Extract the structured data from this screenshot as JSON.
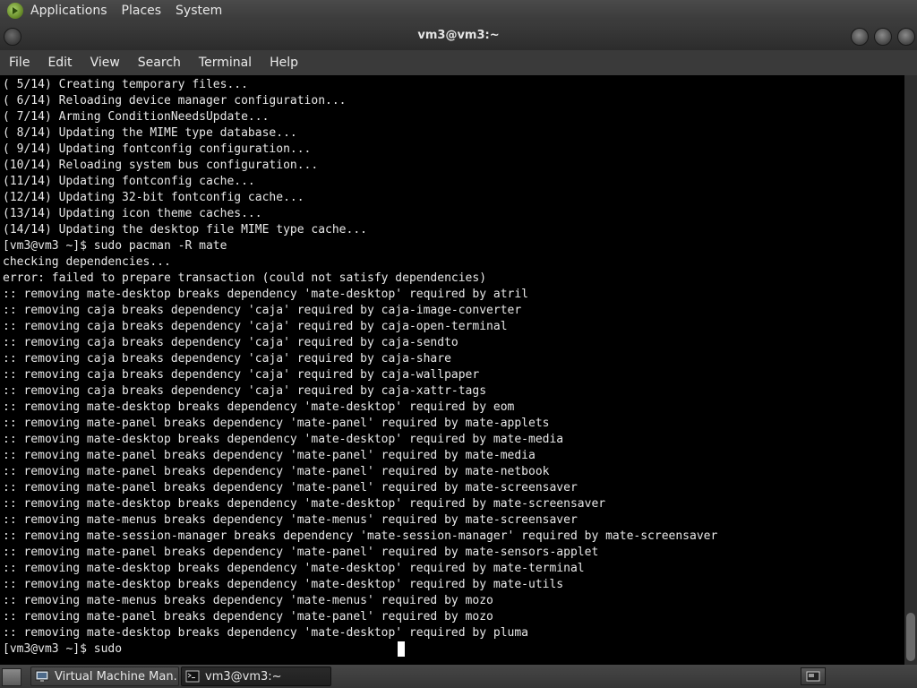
{
  "top_panel": {
    "menus": [
      "Applications",
      "Places",
      "System"
    ]
  },
  "window": {
    "title": "vm3@vm3:~"
  },
  "menubar": {
    "items": [
      "File",
      "Edit",
      "View",
      "Search",
      "Terminal",
      "Help"
    ]
  },
  "terminal": {
    "lines": [
      "( 5/14) Creating temporary files...",
      "( 6/14) Reloading device manager configuration...",
      "( 7/14) Arming ConditionNeedsUpdate...",
      "( 8/14) Updating the MIME type database...",
      "( 9/14) Updating fontconfig configuration...",
      "(10/14) Reloading system bus configuration...",
      "(11/14) Updating fontconfig cache...",
      "(12/14) Updating 32-bit fontconfig cache...",
      "(13/14) Updating icon theme caches...",
      "(14/14) Updating the desktop file MIME type cache...",
      "[vm3@vm3 ~]$ sudo pacman -R mate",
      "checking dependencies...",
      "error: failed to prepare transaction (could not satisfy dependencies)",
      ":: removing mate-desktop breaks dependency 'mate-desktop' required by atril",
      ":: removing caja breaks dependency 'caja' required by caja-image-converter",
      ":: removing caja breaks dependency 'caja' required by caja-open-terminal",
      ":: removing caja breaks dependency 'caja' required by caja-sendto",
      ":: removing caja breaks dependency 'caja' required by caja-share",
      ":: removing caja breaks dependency 'caja' required by caja-wallpaper",
      ":: removing caja breaks dependency 'caja' required by caja-xattr-tags",
      ":: removing mate-desktop breaks dependency 'mate-desktop' required by eom",
      ":: removing mate-panel breaks dependency 'mate-panel' required by mate-applets",
      ":: removing mate-desktop breaks dependency 'mate-desktop' required by mate-media",
      ":: removing mate-panel breaks dependency 'mate-panel' required by mate-media",
      ":: removing mate-panel breaks dependency 'mate-panel' required by mate-netbook",
      ":: removing mate-panel breaks dependency 'mate-panel' required by mate-screensaver",
      ":: removing mate-desktop breaks dependency 'mate-desktop' required by mate-screensaver",
      ":: removing mate-menus breaks dependency 'mate-menus' required by mate-screensaver",
      ":: removing mate-session-manager breaks dependency 'mate-session-manager' required by mate-screensaver",
      ":: removing mate-panel breaks dependency 'mate-panel' required by mate-sensors-applet",
      ":: removing mate-desktop breaks dependency 'mate-desktop' required by mate-terminal",
      ":: removing mate-desktop breaks dependency 'mate-desktop' required by mate-utils",
      ":: removing mate-menus breaks dependency 'mate-menus' required by mozo",
      ":: removing mate-panel breaks dependency 'mate-panel' required by mozo",
      ":: removing mate-desktop breaks dependency 'mate-desktop' required by pluma"
    ],
    "prompt": "[vm3@vm3 ~]$ sudo"
  },
  "taskbar": {
    "tasks": [
      {
        "label": "Virtual Machine Man...",
        "icon": "virtual-machine-manager-icon"
      },
      {
        "label": "vm3@vm3:~",
        "icon": "terminal-icon"
      }
    ],
    "tray_icon": "workspace-switcher-icon"
  },
  "colors": {
    "terminal_bg": "#000000",
    "terminal_fg": "#e8e8e8",
    "panel_bg": "#3a3a3a"
  }
}
